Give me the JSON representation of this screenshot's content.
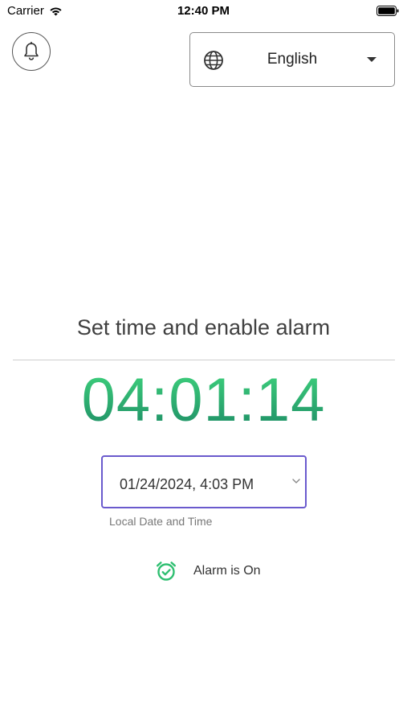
{
  "status_bar": {
    "carrier": "Carrier",
    "time": "12:40 PM",
    "icons": [
      "wifi-icon",
      "battery-icon"
    ]
  },
  "header": {
    "bell_icon": "bell-icon",
    "language": {
      "selected": "English",
      "icon": "globe-icon"
    }
  },
  "main": {
    "title": "Set time and enable alarm",
    "countdown": "04:01:14",
    "countdown_color": "#2fb575",
    "datetime_input": {
      "value": "01/24/2024, 4:03 PM",
      "helper": "Local Date and Time",
      "border_color": "#6a5acd"
    },
    "alarm": {
      "status": "Alarm is On",
      "icon": "alarm-clock-check-icon",
      "icon_color": "#2fbf71"
    }
  }
}
